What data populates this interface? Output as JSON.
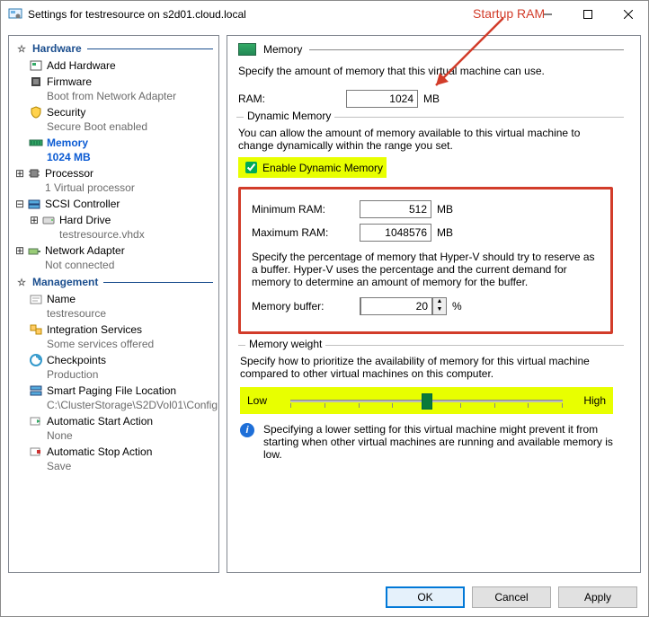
{
  "window": {
    "title": "Settings for testresource on s2d01.cloud.local"
  },
  "annotation": {
    "label": "Startup RAM"
  },
  "tree": {
    "hardware_header": "Hardware",
    "management_header": "Management",
    "items": {
      "add_hardware": "Add Hardware",
      "firmware": "Firmware",
      "firmware_sub": "Boot from Network Adapter",
      "security": "Security",
      "security_sub": "Secure Boot enabled",
      "memory": "Memory",
      "memory_sub": "1024 MB",
      "processor": "Processor",
      "processor_sub": "1 Virtual processor",
      "scsi": "SCSI Controller",
      "hard_drive": "Hard Drive",
      "hard_drive_sub": "testresource.vhdx",
      "netadapter": "Network Adapter",
      "netadapter_sub": "Not connected",
      "name": "Name",
      "name_sub": "testresource",
      "integration": "Integration Services",
      "integration_sub": "Some services offered",
      "checkpoints": "Checkpoints",
      "checkpoints_sub": "Production",
      "paging": "Smart Paging File Location",
      "paging_sub": "C:\\ClusterStorage\\S2DVol01\\Config",
      "autostart": "Automatic Start Action",
      "autostart_sub": "None",
      "autostop": "Automatic Stop Action",
      "autostop_sub": "Save"
    }
  },
  "panel": {
    "title": "Memory",
    "spec": "Specify the amount of memory that this virtual machine can use.",
    "ram_label": "RAM:",
    "ram_value": "1024",
    "ram_unit": "MB",
    "dyn_title": "Dynamic Memory",
    "dyn_desc": "You can allow the amount of memory available to this virtual machine to change dynamically within the range you set.",
    "dyn_enable": "Enable Dynamic Memory",
    "min_label": "Minimum RAM:",
    "min_value": "512",
    "max_label": "Maximum RAM:",
    "max_value": "1048576",
    "buf_desc": "Specify the percentage of memory that Hyper-V should try to reserve as a buffer. Hyper-V uses the percentage and the current demand for memory to determine an amount of memory for the buffer.",
    "buf_label": "Memory buffer:",
    "buf_value": "20",
    "buf_unit": "%",
    "weight_title": "Memory weight",
    "weight_desc": "Specify how to prioritize the availability of memory for this virtual machine compared to other virtual machines on this computer.",
    "low": "Low",
    "high": "High",
    "info": "Specifying a lower setting for this virtual machine might prevent it from starting when other virtual machines are running and available memory is low."
  },
  "buttons": {
    "ok": "OK",
    "cancel": "Cancel",
    "apply": "Apply"
  }
}
